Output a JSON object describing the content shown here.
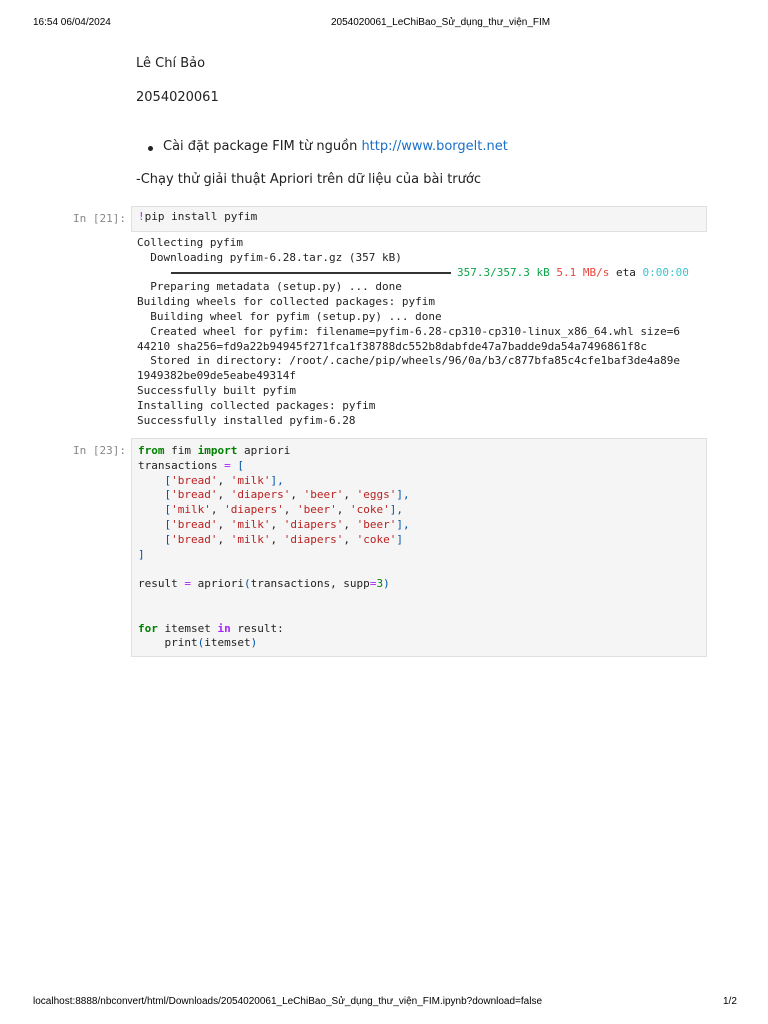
{
  "header": {
    "datetime": "16:54 06/04/2024",
    "title": "2054020061_LeChiBao_Sử_dụng_thư_viện_FIM"
  },
  "footer": {
    "url": "localhost:8888/nbconvert/html/Downloads/2054020061_LeChiBao_Sử_dụng_thư_viện_FIM.ipynb?download=false",
    "page": "1/2"
  },
  "markdown": {
    "name": "Lê Chí Bảo",
    "student_id": "2054020061",
    "bullet_text": "Cài đặt package FIM từ nguồn ",
    "bullet_link": "http://www.borgelt.net",
    "note": "-Chạy thử giải thuật Apriori trên dữ liệu của bài trước"
  },
  "cell1": {
    "prompt": "In [21]:",
    "code": [
      [
        [
          "!",
          "op"
        ],
        [
          "pip install pyfim",
          ""
        ]
      ]
    ]
  },
  "output1": {
    "lines_before": [
      "Collecting pyfim",
      "  Downloading pyfim-6.28.tar.gz (357 kB)"
    ],
    "progress": {
      "value": 1.0,
      "size": "357.3/357.3 kB",
      "speed": "5.1 MB/s",
      "eta_label": "eta",
      "eta": "0:00:00"
    },
    "lines_after": [
      "  Preparing metadata (setup.py) ... done",
      "Building wheels for collected packages: pyfim",
      "  Building wheel for pyfim (setup.py) ... done",
      "  Created wheel for pyfim: filename=pyfim-6.28-cp310-cp310-linux_x86_64.whl size=6",
      "44210 sha256=fd9a22b94945f271fca1f38788dc552b8dabfde47a7badde9da54a7496861f8c",
      "  Stored in directory: /root/.cache/pip/wheels/96/0a/b3/c877bfa85c4cfe1baf3de4a89e",
      "1949382be09de5eabe49314f",
      "Successfully built pyfim",
      "Installing collected packages: pyfim",
      "Successfully installed pyfim-6.28"
    ]
  },
  "cell2": {
    "prompt": "In [23]:",
    "code": [
      [
        [
          "from",
          "kw"
        ],
        [
          " fim ",
          ""
        ],
        [
          "import",
          "kw"
        ],
        [
          " apriori",
          ""
        ]
      ],
      [
        [
          "transactions ",
          ""
        ],
        [
          "=",
          "op"
        ],
        [
          " ",
          ""
        ],
        [
          "[",
          "br"
        ]
      ],
      [
        [
          "    ",
          ""
        ],
        [
          "[",
          "br"
        ],
        [
          "'bread'",
          "str"
        ],
        [
          ", ",
          ""
        ],
        [
          "'milk'",
          "str"
        ],
        [
          "],",
          "br"
        ]
      ],
      [
        [
          "    ",
          ""
        ],
        [
          "[",
          "br"
        ],
        [
          "'bread'",
          "str"
        ],
        [
          ", ",
          ""
        ],
        [
          "'diapers'",
          "str"
        ],
        [
          ", ",
          ""
        ],
        [
          "'beer'",
          "str"
        ],
        [
          ", ",
          ""
        ],
        [
          "'eggs'",
          "str"
        ],
        [
          "],",
          "br"
        ]
      ],
      [
        [
          "    ",
          ""
        ],
        [
          "[",
          "br"
        ],
        [
          "'milk'",
          "str"
        ],
        [
          ", ",
          ""
        ],
        [
          "'diapers'",
          "str"
        ],
        [
          ", ",
          ""
        ],
        [
          "'beer'",
          "str"
        ],
        [
          ", ",
          ""
        ],
        [
          "'coke'",
          "str"
        ],
        [
          "],",
          "br"
        ]
      ],
      [
        [
          "    ",
          ""
        ],
        [
          "[",
          "br"
        ],
        [
          "'bread'",
          "str"
        ],
        [
          ", ",
          ""
        ],
        [
          "'milk'",
          "str"
        ],
        [
          ", ",
          ""
        ],
        [
          "'diapers'",
          "str"
        ],
        [
          ", ",
          ""
        ],
        [
          "'beer'",
          "str"
        ],
        [
          "],",
          "br"
        ]
      ],
      [
        [
          "    ",
          ""
        ],
        [
          "[",
          "br"
        ],
        [
          "'bread'",
          "str"
        ],
        [
          ", ",
          ""
        ],
        [
          "'milk'",
          "str"
        ],
        [
          ", ",
          ""
        ],
        [
          "'diapers'",
          "str"
        ],
        [
          ", ",
          ""
        ],
        [
          "'coke'",
          "str"
        ],
        [
          "]",
          "br"
        ]
      ],
      [
        [
          "]",
          "br"
        ]
      ],
      [],
      [
        [
          "result ",
          ""
        ],
        [
          "=",
          "op"
        ],
        [
          " apriori",
          ""
        ],
        [
          "(",
          "br"
        ],
        [
          "transactions, supp",
          ""
        ],
        [
          "=",
          "op"
        ],
        [
          "3",
          "num"
        ],
        [
          ")",
          "br"
        ]
      ],
      [],
      [],
      [
        [
          "for",
          "kw"
        ],
        [
          " itemset ",
          ""
        ],
        [
          "in",
          "kw2"
        ],
        [
          " result:",
          ""
        ]
      ],
      [
        [
          "    print",
          ""
        ],
        [
          "(",
          "br"
        ],
        [
          "itemset",
          ""
        ],
        [
          ")",
          "br"
        ]
      ]
    ]
  }
}
